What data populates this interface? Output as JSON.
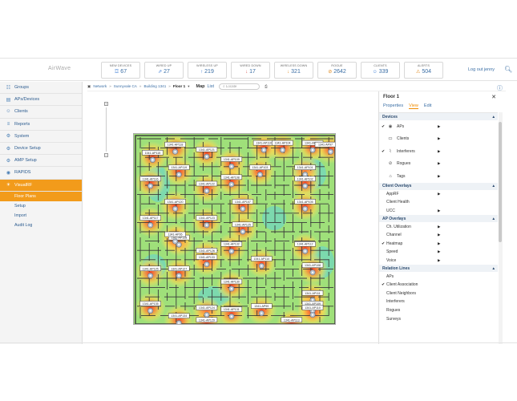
{
  "brand": "AirWave",
  "stats": [
    {
      "label": "NEW DEVICES",
      "value": "67",
      "icon": "device-icon",
      "color": "#3a7bd5"
    },
    {
      "label": "WIRED UP",
      "value": "27",
      "icon": "wired-up-icon",
      "color": "#3a7bd5"
    },
    {
      "label": "WIRELESS UP",
      "value": "219",
      "icon": "wireless-up-icon",
      "color": "#3a7bd5"
    },
    {
      "label": "WIRED DOWN",
      "value": "17",
      "icon": "wired-down-icon",
      "color": "#d9534f"
    },
    {
      "label": "WIRELESS DOWN",
      "value": "321",
      "icon": "wireless-down-icon",
      "color": "#e08a1e"
    },
    {
      "label": "ROGUE",
      "value": "2642",
      "icon": "rogue-icon",
      "color": "#e08a1e"
    },
    {
      "label": "CLIENTS",
      "value": "339",
      "icon": "clients-icon",
      "color": "#3a7bd5"
    },
    {
      "label": "ALERTS",
      "value": "504",
      "icon": "alert-icon",
      "color": "#e08a1e"
    }
  ],
  "header": {
    "logout": "Log out jenny"
  },
  "sidebar": {
    "items": [
      {
        "label": "Groups",
        "icon": "groups-icon"
      },
      {
        "label": "APs/Devices",
        "icon": "devices-icon"
      },
      {
        "label": "Clients",
        "icon": "clients-icon"
      },
      {
        "label": "Reports",
        "icon": "reports-icon"
      },
      {
        "label": "System",
        "icon": "system-icon"
      },
      {
        "label": "Device Setup",
        "icon": "device-setup-icon"
      },
      {
        "label": "AMP Setup",
        "icon": "amp-setup-icon"
      },
      {
        "label": "RAPIDS",
        "icon": "rapids-icon"
      },
      {
        "label": "VisualRF",
        "icon": "visualrf-icon"
      }
    ],
    "subitems": [
      "Floor Plans",
      "Setup",
      "Import",
      "Audit Log"
    ]
  },
  "breadcrumb": {
    "network": "Network",
    "sep": "»",
    "campus": "Sunnyvale CA",
    "building": "Building 1341",
    "floor": "Floor 1"
  },
  "view_tabs": {
    "map": "Map",
    "list": "List"
  },
  "search": {
    "placeholder": "Locate"
  },
  "panel": {
    "title": "Floor 1",
    "tabs": [
      "Properties",
      "View",
      "Edit"
    ],
    "active_tab": "View",
    "sections": [
      {
        "title": "Devices",
        "rows": [
          {
            "label": "APs",
            "checked": true,
            "icon": "ap-icon",
            "arrow": true
          },
          {
            "label": "Clients",
            "checked": false,
            "icon": "monitor-icon",
            "arrow": true
          },
          {
            "label": "Interferers",
            "checked": true,
            "icon": "interferer-icon",
            "arrow": true
          },
          {
            "label": "Rogues",
            "checked": false,
            "icon": "rogue-icon",
            "arrow": true
          },
          {
            "label": "Tags",
            "checked": false,
            "icon": "tag-icon",
            "arrow": true
          }
        ]
      },
      {
        "title": "Client Overlays",
        "rows": [
          {
            "label": "AppRF",
            "arrow": true
          },
          {
            "label": "Client Health",
            "arrow": false
          },
          {
            "label": "UCC",
            "arrow": true
          }
        ]
      },
      {
        "title": "AP Overlays",
        "rows": [
          {
            "label": "Ch. Utilization",
            "arrow": true
          },
          {
            "label": "Channel",
            "arrow": true
          },
          {
            "label": "Heatmap",
            "checked": true,
            "arrow": true
          },
          {
            "label": "Speed",
            "arrow": true
          },
          {
            "label": "Voice",
            "arrow": true
          }
        ]
      },
      {
        "title": "Relation Lines",
        "rows": [
          {
            "label": "APs"
          },
          {
            "label": "Client Association",
            "checked": true
          },
          {
            "label": "Client Neighbors"
          },
          {
            "label": "Interferers"
          },
          {
            "label": "Rogues"
          },
          {
            "label": "Surveys"
          }
        ]
      }
    ]
  },
  "map_aps": [
    "1341-AP118",
    "1341-AP121",
    "1341-AP110",
    "1341-AP104",
    "1341-AP106",
    "1341-AP97",
    "1341-AP115",
    "1341-AP119",
    "1341-AP109",
    "1341-AP103",
    "1341-AP101",
    "1341-AP116",
    "1341-AP108",
    "1341-AP122",
    "1341-AP102",
    "1341-AP120",
    "1341-AP123",
    "1341-AP107",
    "1341-AP105",
    "1341-AP117",
    "1341-AP128",
    "1341-AP125",
    "1341-AP95",
    "1341-AP126",
    "1341-AP132",
    "1341-AP112",
    "1341-AP133",
    "1341-AP114",
    "1341-AP108",
    "1341-AP125",
    "1341-AP127",
    "1341-AP130",
    "1341-AP111",
    "1341-AP135",
    "1341-AP134",
    "1341-AP124",
    "1341-AP131",
    "1341-AP99",
    "1341-AP109",
    "1341-AP129",
    "1341-AP113",
    "1341-AP110"
  ]
}
